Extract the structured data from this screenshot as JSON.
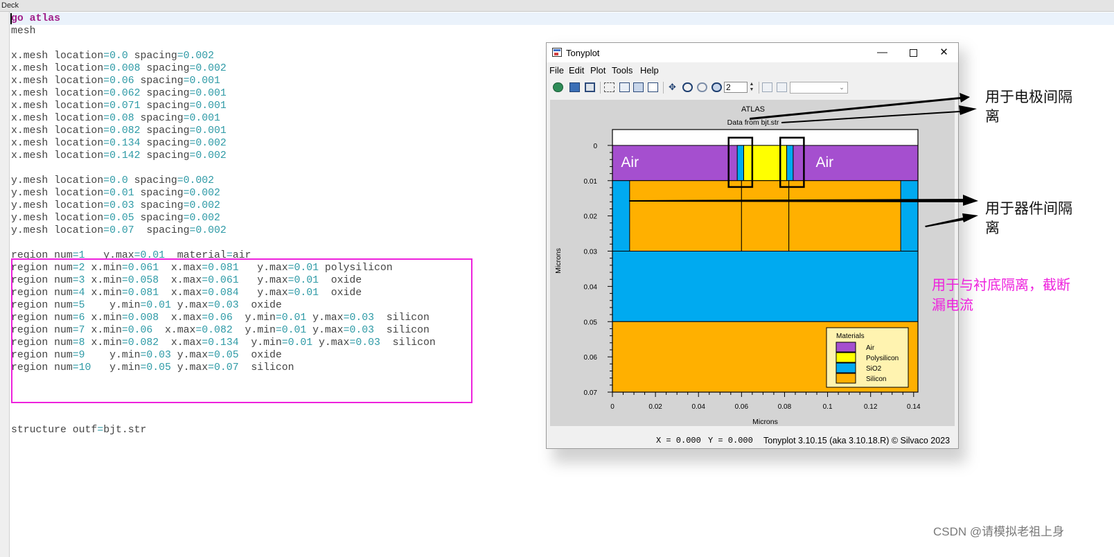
{
  "deck": {
    "title": "Deck",
    "lines": [
      "go atlas",
      "mesh",
      "",
      "x.mesh location=0.0 spacing=0.002",
      "x.mesh location=0.008 spacing=0.002",
      "x.mesh location=0.06 spacing=0.001",
      "x.mesh location=0.062 spacing=0.001",
      "x.mesh location=0.071 spacing=0.001",
      "x.mesh location=0.08 spacing=0.001",
      "x.mesh location=0.082 spacing=0.001",
      "x.mesh location=0.134 spacing=0.002",
      "x.mesh location=0.142 spacing=0.002",
      "",
      "y.mesh location=0.0 spacing=0.002",
      "y.mesh location=0.01 spacing=0.002",
      "y.mesh location=0.03 spacing=0.002",
      "y.mesh location=0.05 spacing=0.002",
      "y.mesh location=0.07  spacing=0.002",
      "",
      "region num=1   y.max=0.01  material=air",
      "region num=2 x.min=0.061  x.max=0.081   y.max=0.01 polysilicon",
      "region num=3 x.min=0.058  x.max=0.061   y.max=0.01  oxide",
      "region num=4 x.min=0.081  x.max=0.084   y.max=0.01  oxide",
      "region num=5    y.min=0.01 y.max=0.03  oxide",
      "region num=6 x.min=0.008  x.max=0.06  y.min=0.01 y.max=0.03  silicon",
      "region num=7 x.min=0.06  x.max=0.082  y.min=0.01 y.max=0.03  silicon",
      "region num=8 x.min=0.082  x.max=0.134  y.min=0.01 y.max=0.03  silicon",
      "region num=9    y.min=0.03 y.max=0.05  oxide",
      "region num=10   y.min=0.05 y.max=0.07  silicon",
      "",
      "",
      "",
      "",
      "structure outf=bjt.str"
    ]
  },
  "tonyplot": {
    "title": "Tonyplot",
    "menu": [
      "File",
      "Edit",
      "Plot",
      "Tools",
      "Help"
    ],
    "toolbar": {
      "zoom_value": "2"
    },
    "status": {
      "x_readout": "X = 0.000",
      "y_readout": "Y = 0.000",
      "version": "Tonyplot 3.10.15 (aka 3.10.18.R) © Silvaco 2023"
    },
    "icons": [
      "load-icon",
      "export-icon",
      "print-icon",
      "select-icon",
      "copy-icon",
      "paste-icon",
      "duplicate-icon",
      "pan-icon",
      "zoom-in-icon",
      "zoom-out-icon",
      "zoom-box-icon",
      "prev-icon",
      "next-icon"
    ]
  },
  "chart_data": {
    "type": "heatmap",
    "title": "ATLAS",
    "subtitle": "Data from bjt.str",
    "xlabel": "Microns",
    "ylabel": "Microns",
    "xlim": [
      0,
      0.142
    ],
    "ylim": [
      0.07,
      -0.0045
    ],
    "xticks": [
      0,
      0.02,
      0.04,
      0.06,
      0.08,
      0.1,
      0.12,
      0.14
    ],
    "xtick_labels": [
      "0",
      "0.02",
      "0.04",
      "0.06",
      "0.08",
      "0.1",
      "0.12",
      "0.14"
    ],
    "yticks": [
      0,
      0.01,
      0.02,
      0.03,
      0.04,
      0.05,
      0.06,
      0.07
    ],
    "ytick_labels": [
      "0",
      "0.01",
      "0.02",
      "0.03",
      "0.04",
      "0.05",
      "0.06",
      "0.07"
    ],
    "regions": [
      {
        "material": "Air",
        "x": [
          0,
          0.142
        ],
        "y": [
          0,
          0.01
        ]
      },
      {
        "material": "Polysilicon",
        "x": [
          0.061,
          0.081
        ],
        "y": [
          0,
          0.01
        ]
      },
      {
        "material": "SiO2",
        "x": [
          0.058,
          0.061
        ],
        "y": [
          0,
          0.01
        ]
      },
      {
        "material": "SiO2",
        "x": [
          0.081,
          0.084
        ],
        "y": [
          0,
          0.01
        ]
      },
      {
        "material": "SiO2",
        "x": [
          0,
          0.142
        ],
        "y": [
          0.01,
          0.03
        ]
      },
      {
        "material": "Silicon",
        "x": [
          0.008,
          0.06
        ],
        "y": [
          0.01,
          0.03
        ]
      },
      {
        "material": "Silicon",
        "x": [
          0.06,
          0.082
        ],
        "y": [
          0.01,
          0.03
        ]
      },
      {
        "material": "Silicon",
        "x": [
          0.082,
          0.134
        ],
        "y": [
          0.01,
          0.03
        ]
      },
      {
        "material": "SiO2",
        "x": [
          0,
          0.142
        ],
        "y": [
          0.03,
          0.05
        ]
      },
      {
        "material": "Silicon",
        "x": [
          0,
          0.142
        ],
        "y": [
          0.05,
          0.07
        ]
      }
    ],
    "region_labels": [
      {
        "text": "Air",
        "x": 0.004,
        "y": 0.0045
      },
      {
        "text": "Air",
        "x": 0.0945,
        "y": 0.0045
      }
    ],
    "highlight_boxes": [
      {
        "x": [
          0.054,
          0.065
        ],
        "y": [
          -0.0022,
          0.0118
        ]
      },
      {
        "x": [
          0.078,
          0.089
        ],
        "y": [
          -0.0022,
          0.0118
        ]
      }
    ],
    "legend": {
      "title": "Materials",
      "position": "bottom-right",
      "items": [
        {
          "name": "Air",
          "color": "#a54fcf"
        },
        {
          "name": "Polysilicon",
          "color": "#ffff00"
        },
        {
          "name": "SiO2",
          "color": "#00aaf0"
        },
        {
          "name": "Silicon",
          "color": "#ffb000"
        }
      ]
    },
    "colors": {
      "Air": "#a54fcf",
      "Polysilicon": "#ffff00",
      "SiO2": "#00aaf0",
      "Silicon": "#ffb000"
    }
  },
  "annotations": {
    "electrode_isolation": "用于电极间隔离",
    "device_isolation": "用于器件间隔离",
    "substrate_isolation": "用于与衬底隔离，截断漏电流"
  },
  "watermark": "CSDN @请模拟老祖上身"
}
